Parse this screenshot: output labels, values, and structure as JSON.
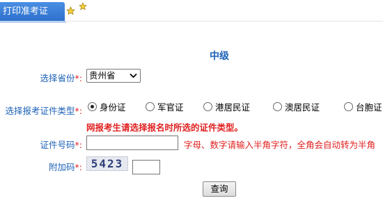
{
  "tab": {
    "label": "打印准考证"
  },
  "title": "中级",
  "province": {
    "label": "选择省份",
    "required_mark": "*:",
    "selected": "贵州省"
  },
  "cert_type": {
    "label": "选择报考证件类型",
    "required_mark": "*:",
    "options": [
      "身份证",
      "军官证",
      "港居民证",
      "澳居民证",
      "台胞证"
    ],
    "selected_index": 0
  },
  "warning": "网报考生请选择报名时所选的证件类型。",
  "cert_number": {
    "label": "证件号码",
    "required_mark": "*:",
    "value": "",
    "hint": "字母、数字请输入半角字符，全角会自动转为半角"
  },
  "captcha": {
    "label": "附加码",
    "required_mark": "*:",
    "image_text": "5423",
    "value": ""
  },
  "query_button": "查询",
  "colors": {
    "tab": "#2d6fcc",
    "label": "#1e63b8",
    "required": "#e02020"
  }
}
